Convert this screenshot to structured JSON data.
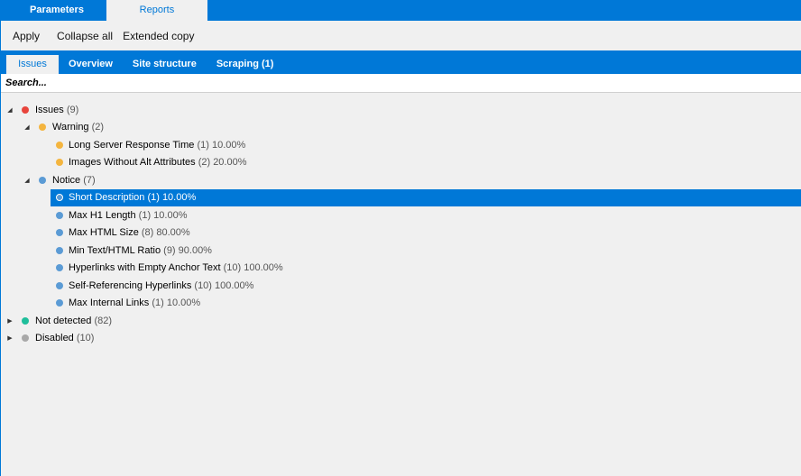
{
  "top_tabs": [
    {
      "label": "Parameters",
      "active": false
    },
    {
      "label": "Reports",
      "active": true
    }
  ],
  "toolbar": {
    "apply_label": "Apply",
    "collapse_label": "Collapse all",
    "copy_label": "Extended copy"
  },
  "sub_tabs": [
    {
      "label": "Issues",
      "active": true
    },
    {
      "label": "Overview",
      "active": false
    },
    {
      "label": "Site structure",
      "active": false
    },
    {
      "label": "Scraping (1)",
      "active": false
    }
  ],
  "search": {
    "placeholder": "Search..."
  },
  "colors": {
    "accent": "#0078d7",
    "error": "#e8453c",
    "warning": "#f4b53f",
    "notice": "#5b9bd5",
    "not_detected": "#1fbe9b",
    "disabled": "#a8a8a8"
  },
  "tree": [
    {
      "label": "Issues",
      "count": "(9)",
      "level": 0,
      "expanded": true,
      "color": "#e8453c"
    },
    {
      "label": "Warning",
      "count": "(2)",
      "level": 1,
      "expanded": true,
      "color": "#f4b53f"
    },
    {
      "label": "Long Server Response Time",
      "count": "(1) 10.00%",
      "level": 2,
      "color": "#f4b53f"
    },
    {
      "label": "Images Without Alt Attributes",
      "count": "(2) 20.00%",
      "level": 2,
      "color": "#f4b53f"
    },
    {
      "label": "Notice",
      "count": "(7)",
      "level": 1,
      "expanded": true,
      "color": "#5b9bd5"
    },
    {
      "label": "Short Description",
      "count": "(1) 10.00%",
      "level": 2,
      "color": "#5b9bd5",
      "selected": true
    },
    {
      "label": "Max H1 Length",
      "count": "(1) 10.00%",
      "level": 2,
      "color": "#5b9bd5"
    },
    {
      "label": "Max HTML Size",
      "count": "(8) 80.00%",
      "level": 2,
      "color": "#5b9bd5"
    },
    {
      "label": "Min Text/HTML Ratio",
      "count": "(9) 90.00%",
      "level": 2,
      "color": "#5b9bd5"
    },
    {
      "label": "Hyperlinks with Empty Anchor Text",
      "count": "(10) 100.00%",
      "level": 2,
      "color": "#5b9bd5"
    },
    {
      "label": "Self-Referencing Hyperlinks",
      "count": "(10) 100.00%",
      "level": 2,
      "color": "#5b9bd5"
    },
    {
      "label": "Max Internal Links",
      "count": "(1) 10.00%",
      "level": 2,
      "color": "#5b9bd5"
    },
    {
      "label": "Not detected",
      "count": "(82)",
      "level": 0,
      "expanded": false,
      "color": "#1fbe9b"
    },
    {
      "label": "Disabled",
      "count": "(10)",
      "level": 0,
      "expanded": false,
      "color": "#a8a8a8"
    }
  ]
}
